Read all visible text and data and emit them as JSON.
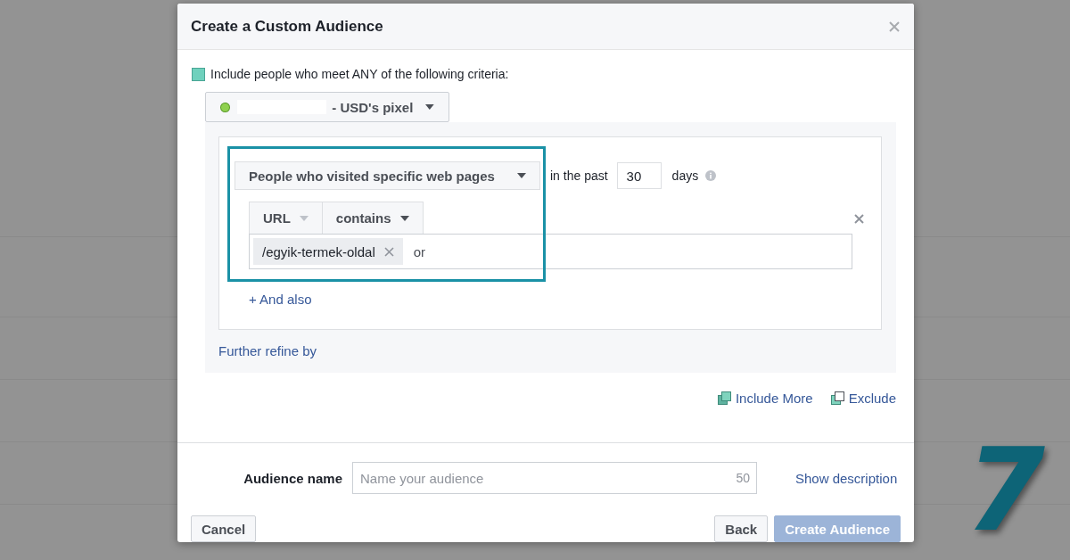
{
  "dialog": {
    "title": "Create a Custom Audience",
    "include_label": "Include people who meet ANY of the following criteria:",
    "pixel": {
      "label": "- USD's pixel"
    },
    "rule": {
      "event": "People who visited specific web pages",
      "past_label": "in the past",
      "days": "30",
      "days_label": "days",
      "field": "URL",
      "operator": "contains",
      "tokens": [
        "/egyik-termek-oldal"
      ],
      "or_label": "or",
      "and_also": "+ And also"
    },
    "refine": "Further refine by",
    "actions": [
      {
        "label": "Include More",
        "kind": "include"
      },
      {
        "label": "Exclude",
        "kind": "exclude"
      }
    ],
    "audience_name": {
      "label": "Audience name",
      "placeholder": "Name your audience",
      "counter": "50"
    },
    "show_description": "Show description",
    "footer": {
      "left_buttons": [
        {
          "label": "Cancel",
          "disabled": false
        }
      ],
      "right_buttons": [
        {
          "label": "Back",
          "disabled": false
        },
        {
          "label": "Create Audience",
          "disabled": true
        }
      ]
    }
  },
  "step_number": "7"
}
